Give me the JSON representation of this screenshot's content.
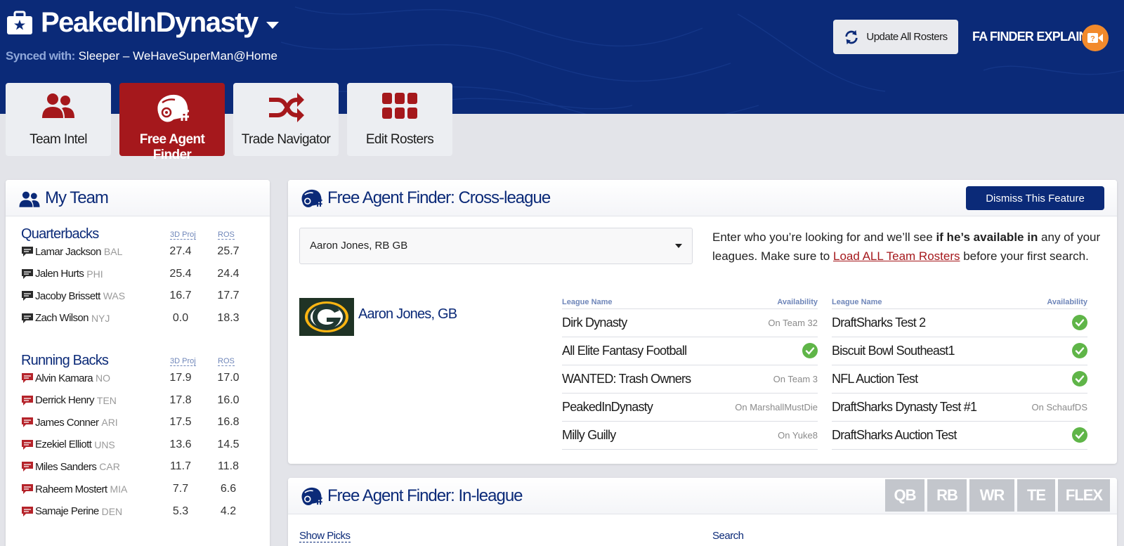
{
  "header": {
    "app_name": "PeakedInDynasty",
    "synced_label": "Synced with:",
    "synced_value": " Sleeper – WeHaveSuperMan@Home",
    "update_button": "Update All Rosters",
    "fa_explained": "FA FINDER EXPLAINED",
    "colors": {
      "navy": "#0b2a78",
      "red": "#a5181c",
      "orange": "#f28a2c",
      "green": "#5fb548"
    }
  },
  "nav": {
    "tabs": [
      {
        "label": "Team Intel",
        "icon": "users-icon",
        "active": false
      },
      {
        "label": "Free Agent Finder",
        "icon": "football-helmet-icon",
        "active": true
      },
      {
        "label": "Trade Navigator",
        "icon": "shuffle-icon",
        "active": false
      },
      {
        "label": "Edit Rosters",
        "icon": "grid-icon",
        "active": false
      }
    ]
  },
  "my_team": {
    "title": "My Team",
    "col_proj": "3D Proj",
    "col_ros": "ROS",
    "quarterbacks": {
      "title": "Quarterbacks",
      "players": [
        {
          "name": "Lamar Jackson",
          "team": "BAL",
          "proj": "27.4",
          "ros": "25.7"
        },
        {
          "name": "Jalen Hurts",
          "team": "PHI",
          "proj": "25.4",
          "ros": "24.4"
        },
        {
          "name": "Jacoby Brissett",
          "team": "WAS",
          "proj": "16.7",
          "ros": "17.7"
        },
        {
          "name": "Zach Wilson",
          "team": "NYJ",
          "proj": "0.0",
          "ros": "18.3"
        }
      ]
    },
    "running_backs": {
      "title": "Running Backs",
      "players": [
        {
          "name": "Alvin Kamara",
          "team": "NO",
          "proj": "17.9",
          "ros": "17.0"
        },
        {
          "name": "Derrick Henry",
          "team": "TEN",
          "proj": "17.8",
          "ros": "16.0"
        },
        {
          "name": "James Conner",
          "team": "ARI",
          "proj": "17.5",
          "ros": "16.8"
        },
        {
          "name": "Ezekiel Elliott",
          "team": "UNS",
          "proj": "13.6",
          "ros": "14.5"
        },
        {
          "name": "Miles Sanders",
          "team": "CAR",
          "proj": "11.7",
          "ros": "11.8"
        },
        {
          "name": "Raheem Mostert",
          "team": "MIA",
          "proj": "7.7",
          "ros": "6.6"
        },
        {
          "name": "Samaje Perine",
          "team": "DEN",
          "proj": "5.3",
          "ros": "4.2"
        }
      ]
    }
  },
  "cross_league": {
    "title": "Free Agent Finder: Cross-league",
    "dismiss": "Dismiss This Feature",
    "select_value": "Aaron Jones, RB GB",
    "help_1": "Enter who you’re looking for and we’ll see ",
    "help_bold": "if he’s available in",
    "help_2": " any of your leagues. Make sure to ",
    "help_link": "Load ALL Team Rosters",
    "help_3": " before your first search.",
    "player_name": "Aaron Jones, GB",
    "col_league": "League Name",
    "col_avail": "Availability",
    "left_leagues": [
      {
        "name": "Dirk Dynasty",
        "avail": "On Team 32",
        "available": false
      },
      {
        "name": "All Elite Fantasy Football",
        "avail": "",
        "available": true
      },
      {
        "name": "WANTED: Trash Owners",
        "avail": "On Team 3",
        "available": false
      },
      {
        "name": "PeakedInDynasty",
        "avail": "On MarshallMustDie",
        "available": false
      },
      {
        "name": "Milly Guilly",
        "avail": "On Yuke8",
        "available": false
      }
    ],
    "right_leagues": [
      {
        "name": "DraftSharks Test 2",
        "avail": "",
        "available": true
      },
      {
        "name": "Biscuit Bowl Southeast1",
        "avail": "",
        "available": true
      },
      {
        "name": "NFL Auction Test",
        "avail": "",
        "available": true
      },
      {
        "name": "DraftSharks Dynasty Test #1",
        "avail": "On SchaufDS",
        "available": false
      },
      {
        "name": "DraftSharks Auction Test",
        "avail": "",
        "available": true
      }
    ]
  },
  "in_league": {
    "title": "Free Agent Finder: In-league",
    "positions": [
      "QB",
      "RB",
      "WR",
      "TE",
      "FLEX"
    ],
    "show_picks": "Show Picks",
    "search_label": "Search"
  }
}
